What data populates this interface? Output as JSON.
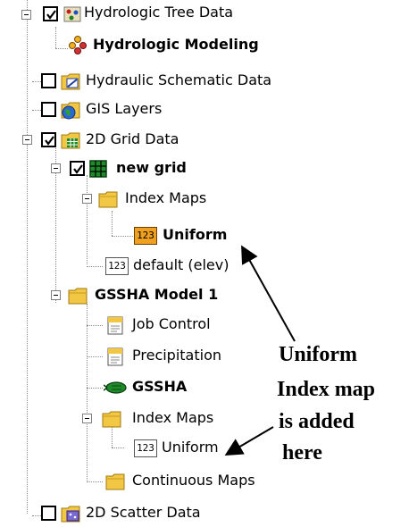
{
  "tree": {
    "items": [
      {
        "label": "Hydrologic Tree Data",
        "icon": "hydrologic-tree-data-icon"
      },
      {
        "label": "Hydrologic Modeling",
        "icon": "hydrologic-modeling-icon"
      },
      {
        "label": "Hydraulic Schematic Data",
        "icon": "hydraulic-schematic-icon"
      },
      {
        "label": "GIS Layers",
        "icon": "gis-globe-icon"
      },
      {
        "label": "2D Grid Data",
        "icon": "grid-folder-icon"
      },
      {
        "label": "new grid",
        "icon": "grid-icon"
      },
      {
        "label": "Index Maps",
        "icon": "folder-icon"
      },
      {
        "label": "Uniform",
        "icon": "index-map-123-icon"
      },
      {
        "label": "default (elev)",
        "icon": "dataset-123-icon"
      },
      {
        "label": "GSSHA Model 1",
        "icon": "folder-icon"
      },
      {
        "label": "Job Control",
        "icon": "job-control-icon"
      },
      {
        "label": "Precipitation",
        "icon": "precipitation-icon"
      },
      {
        "label": "GSSHA",
        "icon": "gssha-model-icon"
      },
      {
        "label": "Index Maps",
        "icon": "folder-icon"
      },
      {
        "label": "Uniform",
        "icon": "index-map-123-icon"
      },
      {
        "label": "Continuous Maps",
        "icon": "folder-icon"
      },
      {
        "label": "2D Scatter Data",
        "icon": "scatter-data-icon"
      }
    ],
    "icon_text": "123"
  },
  "annotation": {
    "line1": "Uniform",
    "line2": "Index map",
    "line3": "is added",
    "line4": "here"
  },
  "colors": {
    "folder": "#f2c744",
    "grid_green": "#1f8a2a",
    "index_orange": "#f0a020",
    "connector": "#8c8c8c"
  }
}
